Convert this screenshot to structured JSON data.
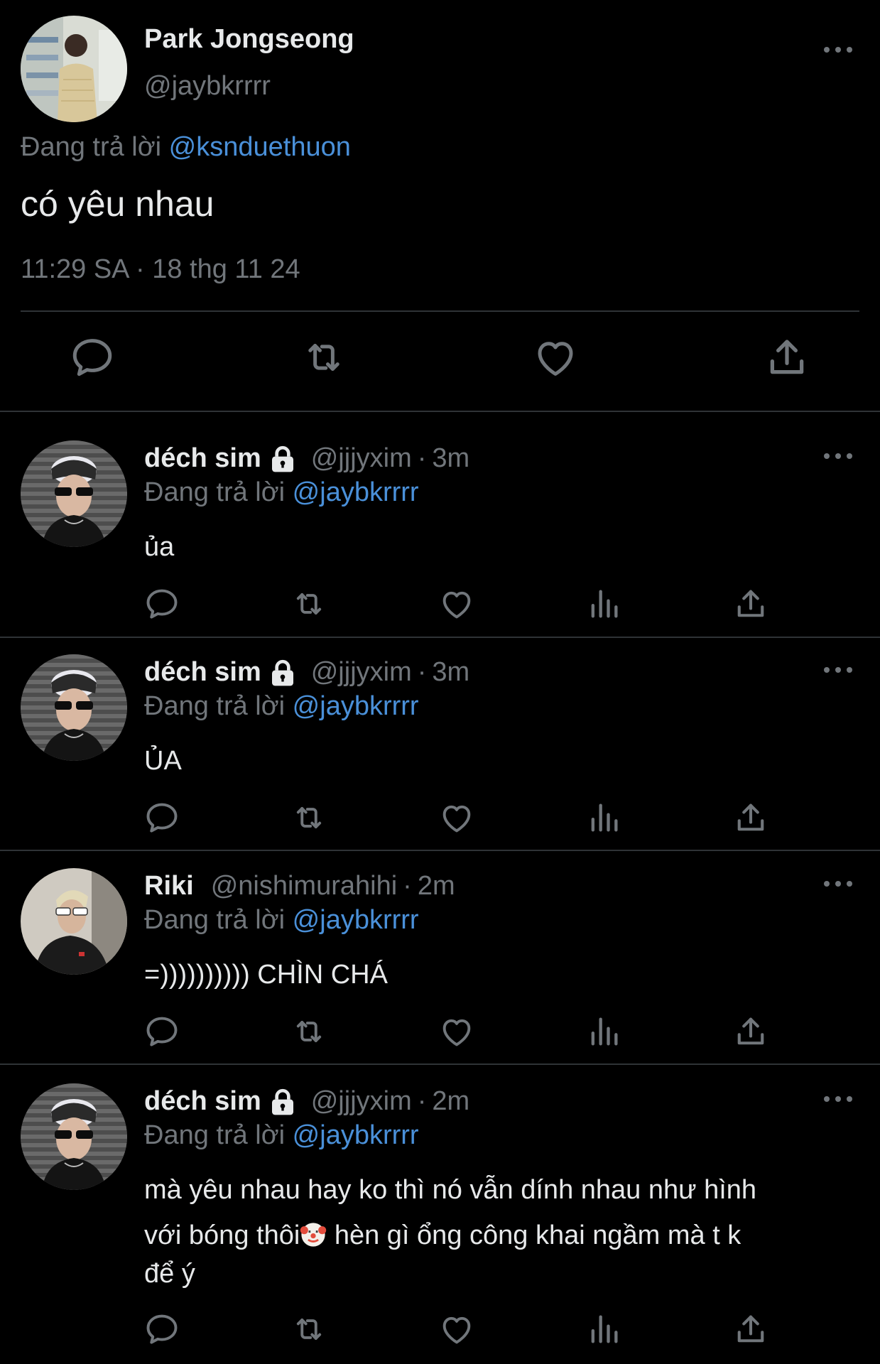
{
  "main_tweet": {
    "name": "Park Jongseong",
    "handle": "@jaybkrrrr",
    "replying_label": "Đang trả lời",
    "replying_to": "@ksnduethuon",
    "text": "có yêu nhau",
    "timestamp": "11:29 SA · 18 thg 11 24",
    "actions": [
      "reply-icon",
      "retweet-icon",
      "like-icon",
      "share-icon"
    ]
  },
  "replies": [
    {
      "name": "déch sim",
      "locked": true,
      "handle": "@jjjyxim",
      "dot": "·",
      "time": "3m",
      "replying_label": "Đang trả lời",
      "replying_to": "@jaybkrrrr",
      "text": "ủa"
    },
    {
      "name": "déch sim",
      "locked": true,
      "handle": "@jjjyxim",
      "dot": "·",
      "time": "3m",
      "replying_label": "Đang trả lời",
      "replying_to": "@jaybkrrrr",
      "text": "ỦA"
    },
    {
      "name": "Riki",
      "locked": false,
      "handle": "@nishimurahihi",
      "dot": "·",
      "time": "2m",
      "replying_label": "Đang trả lời",
      "replying_to": "@jaybkrrrr",
      "text": "=)))))))))) CHÌN CHÁ"
    },
    {
      "name": "déch sim",
      "locked": true,
      "handle": "@jjjyxim",
      "dot": "·",
      "time": "2m",
      "replying_label": "Đang trả lời",
      "replying_to": "@jaybkrrrr",
      "text_line1": "mà yêu nhau hay ko thì nó vẫn dính nhau như hình",
      "text_line2a": "với bóng thôi",
      "text_emoji": "clown-face-emoji",
      "text_line2b": " hèn gì ổng công khai ngầm mà t k",
      "text_line3": "để ý"
    }
  ],
  "colors": {
    "background": "#000000",
    "text": "#e7e9ea",
    "muted": "#71767b",
    "link": "#4a90d9",
    "divider": "#2f3336"
  }
}
